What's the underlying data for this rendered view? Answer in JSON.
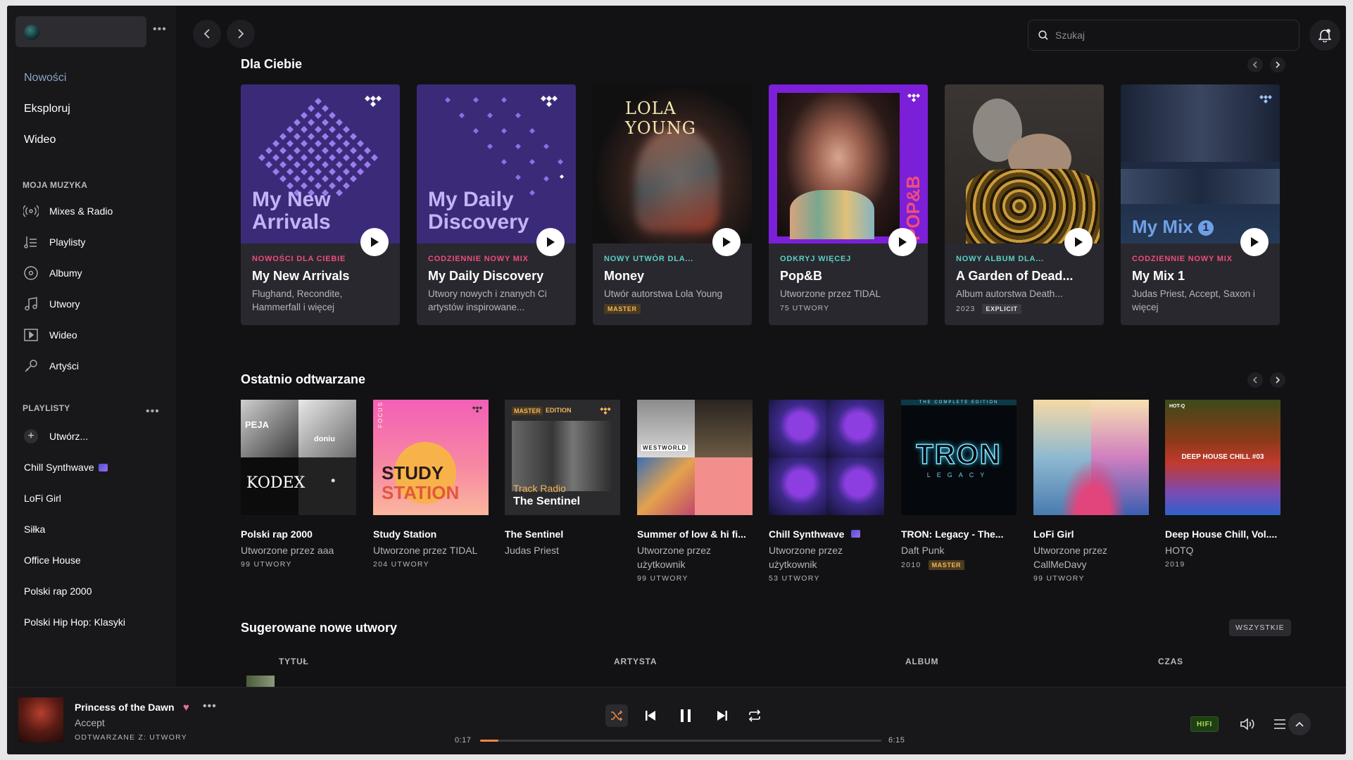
{
  "sidebar": {
    "nav": [
      {
        "label": "Nowości",
        "active": true
      },
      {
        "label": "Eksploruj",
        "active": false
      },
      {
        "label": "Wideo",
        "active": false
      }
    ],
    "my_music_title": "MOJA MUZYKA",
    "my_music": [
      {
        "label": "Mixes & Radio",
        "icon": "radio-icon"
      },
      {
        "label": "Playlisty",
        "icon": "playlist-icon"
      },
      {
        "label": "Albumy",
        "icon": "album-icon"
      },
      {
        "label": "Utwory",
        "icon": "note-icon"
      },
      {
        "label": "Wideo",
        "icon": "video-icon"
      },
      {
        "label": "Artyści",
        "icon": "microphone-icon"
      }
    ],
    "playlists_title": "PLAYLISTY",
    "create_label": "Utwórz...",
    "playlists": [
      "Chill Synthwave",
      "LoFi Girl",
      "Siłka",
      "Office House",
      "Polski rap 2000",
      "Polski Hip Hop: Klasyki"
    ]
  },
  "search": {
    "placeholder": "Szukaj"
  },
  "for_you": {
    "title": "Dla Ciebie",
    "cards": [
      {
        "kicker": "NOWOŚCI DLA CIEBIE",
        "kicker_color": "#ef4d7a",
        "title": "My New Arrivals",
        "sub": "Flughand, Recondite, Hammerfall i więcej",
        "art_text": "My New Arrivals"
      },
      {
        "kicker": "CODZIENNIE NOWY MIX",
        "kicker_color": "#ef4d7a",
        "title": "My Daily Discovery",
        "sub": "Utwory nowych i znanych Ci artystów inspirowane...",
        "art_text": "My Daily Discovery"
      },
      {
        "kicker": "NOWY UTWÓR DLA...",
        "kicker_color": "#5ad1c4",
        "title": "Money",
        "sub": "Utwór autorstwa Lola Young",
        "badge": "MASTER",
        "art_text": "LOLA YOUNG"
      },
      {
        "kicker": "ODKRYJ WIĘCEJ",
        "kicker_color": "#5ad1c4",
        "title": "Pop&B",
        "sub": "Utworzone przez TIDAL",
        "meta": "75 UTWORY",
        "art_text": "POP&B"
      },
      {
        "kicker": "NOWY ALBUM DLA...",
        "kicker_color": "#5ad1c4",
        "title": "A Garden of Dead...",
        "sub": "Album autorstwa Death...",
        "meta": "2023",
        "badge": "EXPLICIT"
      },
      {
        "kicker": "CODZIENNIE NOWY MIX",
        "kicker_color": "#ef4d7a",
        "title": "My Mix 1",
        "sub": "Judas Priest, Accept, Saxon i więcej",
        "art_text": "My Mix",
        "art_num": "1"
      }
    ]
  },
  "recent": {
    "title": "Ostatnio odtwarzane",
    "items": [
      {
        "title": "Polski rap 2000",
        "sub": "Utworzone przez aaa",
        "meta": "99 UTWORY",
        "art_text": [
          "PEJA",
          "doniu",
          "KODEX"
        ]
      },
      {
        "title": "Study Station",
        "sub": "Utworzone przez TIDAL",
        "meta": "204 UTWORY",
        "art_text": [
          "STUDY",
          "STATION",
          "FOCUS"
        ]
      },
      {
        "title": "The Sentinel",
        "sub": "Judas Priest",
        "art_text": [
          "MASTER",
          "EDITION",
          "Track Radio",
          "The Sentinel"
        ]
      },
      {
        "title": "Summer of low & hi fi...",
        "sub": "Utworzone przez użytkownik",
        "meta": "99 UTWORY",
        "art_text": [
          "WESTWORLD"
        ]
      },
      {
        "title": "Chill Synthwave",
        "sub": "Utworzone przez użytkownik",
        "meta": "53 UTWORY"
      },
      {
        "title": "TRON: Legacy - The...",
        "sub": "Daft Punk",
        "meta": "2010",
        "badge": "MASTER",
        "art_text": [
          "THE COMPLETE EDITION",
          "TRON",
          "LEGACY"
        ]
      },
      {
        "title": "LoFi Girl",
        "sub": "Utworzone przez CallMeDavy",
        "meta": "99 UTWORY"
      },
      {
        "title": "Deep House Chill, Vol....",
        "sub": "HOTQ",
        "meta": "2019",
        "art_text": [
          "HOT-Q",
          "DEEP HOUSE CHILL #03"
        ]
      }
    ]
  },
  "suggested": {
    "title": "Sugerowane nowe utwory",
    "all_label": "WSZYSTKIE",
    "columns": [
      "TYTUŁ",
      "ARTYSTA",
      "ALBUM",
      "CZAS"
    ]
  },
  "player": {
    "title": "Princess of the Dawn",
    "artist": "Accept",
    "from": "ODTWARZANE Z: UTWORY",
    "elapsed": "0:17",
    "duration": "6:15",
    "progress": 0.045,
    "quality": "HIFI"
  },
  "colors": {
    "accent": "#f08646",
    "pink": "#ef4d7a",
    "teal": "#5ad1c4",
    "hifi": "#a6e04b"
  }
}
